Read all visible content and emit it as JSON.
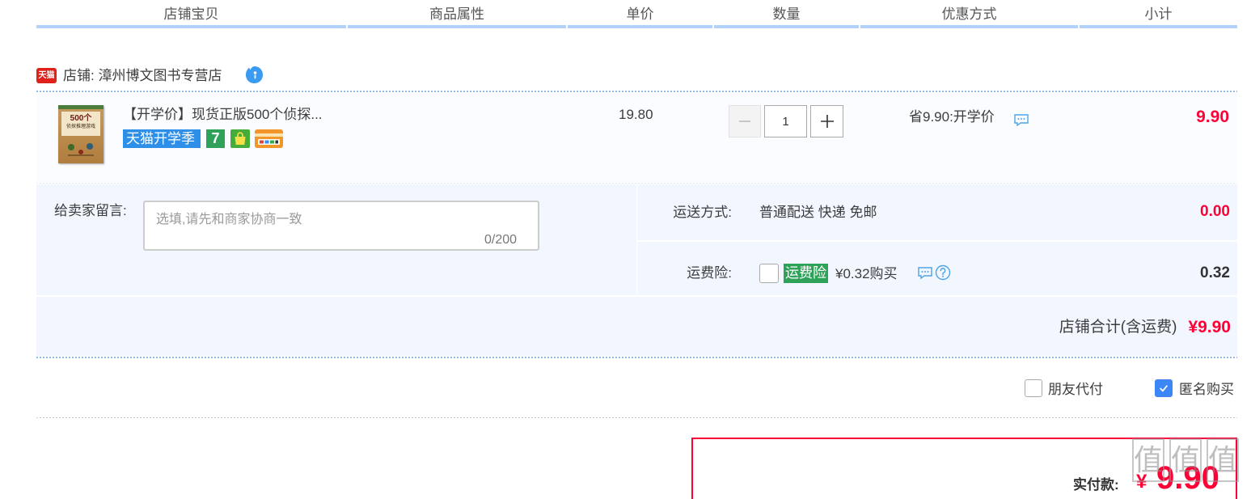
{
  "header": {
    "columns": [
      "店铺宝贝",
      "商品属性",
      "单价",
      "数量",
      "优惠方式",
      "小计"
    ]
  },
  "shop": {
    "logo_text": "天猫",
    "label": "店铺: 漳州博文图书专营店"
  },
  "item": {
    "cover_title": "500个",
    "cover_subtitle": "侦探推理游戏",
    "title": "【开学价】现货正版500个侦探...",
    "badges": [
      "天猫开学季",
      "7"
    ],
    "price": "19.80",
    "quantity": "1",
    "discount": "省9.90:开学价",
    "subtotal": "9.90"
  },
  "message": {
    "label": "给卖家留言:",
    "placeholder": "选填,请先和商家协商一致",
    "counter": "0/200"
  },
  "shipping": {
    "label": "运送方式:",
    "value": "普通配送 快递 免邮",
    "cost": "0.00"
  },
  "insurance": {
    "label": "运费险:",
    "checked": false,
    "badge": "运费险",
    "price_text": "¥0.32购买",
    "cost": "0.32"
  },
  "shop_total": {
    "label": "店铺合计(含运费)",
    "amount": "¥9.90"
  },
  "options": [
    {
      "label": "朋友代付",
      "checked": false
    },
    {
      "label": "匿名购买",
      "checked": true
    }
  ],
  "payment": {
    "label": "实付款:",
    "currency": "¥",
    "amount": "9.90"
  },
  "watermark": {
    "chars": [
      "值",
      "值",
      "值"
    ]
  },
  "icons": [
    "tmall-logo-icon",
    "wangwang-chat-icon",
    "seven-day-return-icon",
    "bag-icon",
    "card-icon",
    "minus-icon",
    "plus-icon",
    "comment-icon",
    "question-icon",
    "checkmark-icon"
  ],
  "colors": {
    "red": "#ff0036",
    "header_bar": "#b2d1ff",
    "row_bg": "#f2f7ff",
    "checkbox_blue": "#3d86f5",
    "badge_green": "#2fa25a",
    "badge_blue": "#2d8fe8",
    "link_blue": "#4ea4e6"
  }
}
